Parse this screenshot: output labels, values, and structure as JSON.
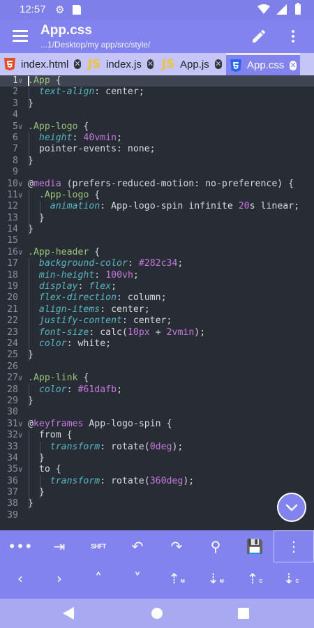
{
  "status": {
    "time": "12:57"
  },
  "app_bar": {
    "title": "App.css",
    "path": "...1/Desktop/my app/src/style/"
  },
  "tabs": [
    {
      "label": "index.html",
      "icon": "html5-icon",
      "active": false
    },
    {
      "label": "index.js",
      "icon": "javascript-icon",
      "active": false
    },
    {
      "label": "App.js",
      "icon": "javascript-icon",
      "active": false
    },
    {
      "label": "App.css",
      "icon": "css3-icon",
      "active": true
    }
  ],
  "tab_icons": {
    "js_text": "JS",
    "close_glyph": "✕"
  },
  "editor": {
    "current_line": 1,
    "lines": [
      {
        "n": "1",
        "fold": "∨",
        "tokens": [
          [
            ".App",
            "t-sel"
          ],
          [
            " {",
            "t-plain"
          ]
        ]
      },
      {
        "n": "2",
        "tokens": [
          [
            "  ",
            "t-plain"
          ],
          [
            "text-align",
            "t-prop"
          ],
          [
            ": center;",
            "t-plain"
          ]
        ]
      },
      {
        "n": "3",
        "tokens": [
          [
            "}",
            "t-plain"
          ]
        ]
      },
      {
        "n": "4",
        "tokens": []
      },
      {
        "n": "5",
        "fold": "∨",
        "tokens": [
          [
            ".App-logo",
            "t-sel"
          ],
          [
            " {",
            "t-plain"
          ]
        ]
      },
      {
        "n": "6",
        "tokens": [
          [
            "  ",
            "t-plain"
          ],
          [
            "height",
            "t-prop"
          ],
          [
            ": ",
            "t-plain"
          ],
          [
            "40",
            "t-num"
          ],
          [
            "vmin",
            "t-unit"
          ],
          [
            ";",
            "t-plain"
          ]
        ]
      },
      {
        "n": "7",
        "tokens": [
          [
            "  pointer-events: none;",
            "t-plain"
          ]
        ]
      },
      {
        "n": "8",
        "tokens": [
          [
            "}",
            "t-plain"
          ]
        ]
      },
      {
        "n": "9",
        "tokens": []
      },
      {
        "n": "10",
        "fold": "∨",
        "tokens": [
          [
            "@",
            "t-plain"
          ],
          [
            "media",
            "t-at"
          ],
          [
            " (prefers-reduced-motion: no-preference) {",
            "t-plain"
          ]
        ]
      },
      {
        "n": "11",
        "fold": "∨",
        "tokens": [
          [
            "  ",
            "t-plain"
          ],
          [
            ".App-logo",
            "t-sel"
          ],
          [
            " {",
            "t-plain"
          ]
        ]
      },
      {
        "n": "12",
        "tokens": [
          [
            "    ",
            "t-plain"
          ],
          [
            "animation",
            "t-prop"
          ],
          [
            ": App-logo-spin infinite ",
            "t-plain"
          ],
          [
            "20",
            "t-num"
          ],
          [
            "s linear;",
            "t-plain"
          ]
        ]
      },
      {
        "n": "13",
        "tokens": [
          [
            "  }",
            "t-plain"
          ]
        ]
      },
      {
        "n": "14",
        "tokens": [
          [
            "}",
            "t-plain"
          ]
        ]
      },
      {
        "n": "15",
        "tokens": []
      },
      {
        "n": "16",
        "fold": "∨",
        "tokens": [
          [
            ".App-header",
            "t-sel"
          ],
          [
            " {",
            "t-plain"
          ]
        ]
      },
      {
        "n": "17",
        "tokens": [
          [
            "  ",
            "t-plain"
          ],
          [
            "background-color",
            "t-prop"
          ],
          [
            ": ",
            "t-plain"
          ],
          [
            "#282c34",
            "t-num"
          ],
          [
            ";",
            "t-plain"
          ]
        ]
      },
      {
        "n": "18",
        "tokens": [
          [
            "  ",
            "t-plain"
          ],
          [
            "min-height",
            "t-prop"
          ],
          [
            ": ",
            "t-plain"
          ],
          [
            "100",
            "t-num"
          ],
          [
            "vh",
            "t-unit"
          ],
          [
            ";",
            "t-plain"
          ]
        ]
      },
      {
        "n": "19",
        "tokens": [
          [
            "  ",
            "t-plain"
          ],
          [
            "display",
            "t-prop"
          ],
          [
            ": ",
            "t-plain"
          ],
          [
            "flex",
            "t-prop"
          ],
          [
            ";",
            "t-plain"
          ]
        ]
      },
      {
        "n": "20",
        "tokens": [
          [
            "  ",
            "t-plain"
          ],
          [
            "flex-direction",
            "t-prop"
          ],
          [
            ": column;",
            "t-plain"
          ]
        ]
      },
      {
        "n": "21",
        "tokens": [
          [
            "  ",
            "t-plain"
          ],
          [
            "align-items",
            "t-prop"
          ],
          [
            ": center;",
            "t-plain"
          ]
        ]
      },
      {
        "n": "22",
        "tokens": [
          [
            "  ",
            "t-plain"
          ],
          [
            "justify-content",
            "t-prop"
          ],
          [
            ": center;",
            "t-plain"
          ]
        ]
      },
      {
        "n": "23",
        "tokens": [
          [
            "  ",
            "t-plain"
          ],
          [
            "font-size",
            "t-prop"
          ],
          [
            ": calc(",
            "t-plain"
          ],
          [
            "10",
            "t-num"
          ],
          [
            "px",
            "t-unit"
          ],
          [
            " + ",
            "t-plain"
          ],
          [
            "2",
            "t-num"
          ],
          [
            "vmin",
            "t-unit"
          ],
          [
            ");",
            "t-plain"
          ]
        ]
      },
      {
        "n": "24",
        "tokens": [
          [
            "  ",
            "t-plain"
          ],
          [
            "color",
            "t-prop"
          ],
          [
            ": white;",
            "t-plain"
          ]
        ]
      },
      {
        "n": "25",
        "tokens": [
          [
            "}",
            "t-plain"
          ]
        ]
      },
      {
        "n": "26",
        "tokens": []
      },
      {
        "n": "27",
        "fold": "∨",
        "tokens": [
          [
            ".App-link",
            "t-sel"
          ],
          [
            " {",
            "t-plain"
          ]
        ]
      },
      {
        "n": "28",
        "tokens": [
          [
            "  ",
            "t-plain"
          ],
          [
            "color",
            "t-prop"
          ],
          [
            ": ",
            "t-plain"
          ],
          [
            "#61dafb",
            "t-num"
          ],
          [
            ";",
            "t-plain"
          ]
        ]
      },
      {
        "n": "29",
        "tokens": [
          [
            "}",
            "t-plain"
          ]
        ]
      },
      {
        "n": "30",
        "tokens": []
      },
      {
        "n": "31",
        "fold": "∨",
        "tokens": [
          [
            "@",
            "t-plain"
          ],
          [
            "keyframes",
            "t-at"
          ],
          [
            " App-logo-spin {",
            "t-plain"
          ]
        ]
      },
      {
        "n": "32",
        "fold": "∨",
        "tokens": [
          [
            "  from {",
            "t-plain"
          ]
        ]
      },
      {
        "n": "33",
        "tokens": [
          [
            "    ",
            "t-plain"
          ],
          [
            "transform",
            "t-prop"
          ],
          [
            ": rotate(",
            "t-plain"
          ],
          [
            "0",
            "t-num"
          ],
          [
            "deg",
            "t-unit"
          ],
          [
            ");",
            "t-plain"
          ]
        ]
      },
      {
        "n": "34",
        "tokens": [
          [
            "  }",
            "t-plain"
          ]
        ]
      },
      {
        "n": "35",
        "fold": "∨",
        "tokens": [
          [
            "  to {",
            "t-plain"
          ]
        ]
      },
      {
        "n": "36",
        "tokens": [
          [
            "    ",
            "t-plain"
          ],
          [
            "transform",
            "t-prop"
          ],
          [
            ": rotate(",
            "t-plain"
          ],
          [
            "360",
            "t-num"
          ],
          [
            "deg",
            "t-unit"
          ],
          [
            ");",
            "t-plain"
          ]
        ]
      },
      {
        "n": "37",
        "tokens": [
          [
            "  }",
            "t-plain"
          ]
        ]
      },
      {
        "n": "38",
        "tokens": [
          [
            "}",
            "t-plain"
          ]
        ]
      },
      {
        "n": "39",
        "tokens": []
      }
    ]
  },
  "toolbar": {
    "row1": [
      {
        "name": "more-symbols-button",
        "glyph": "•••"
      },
      {
        "name": "tab-key-button",
        "glyph": "⇥"
      },
      {
        "name": "shift-button",
        "glyph": "SHFT"
      },
      {
        "name": "undo-button",
        "glyph": "↶"
      },
      {
        "name": "redo-button",
        "glyph": "↷"
      },
      {
        "name": "search-button",
        "glyph": "⚲"
      },
      {
        "name": "save-button",
        "glyph": "💾"
      },
      {
        "name": "overflow-menu-button",
        "glyph": "⋮"
      }
    ],
    "row2": [
      {
        "name": "cursor-left-button",
        "glyph": "‹",
        "sub": ""
      },
      {
        "name": "cursor-right-button",
        "glyph": "›",
        "sub": ""
      },
      {
        "name": "cursor-up-button",
        "glyph": "˄",
        "sub": ""
      },
      {
        "name": "cursor-down-button",
        "glyph": "˅",
        "sub": ""
      },
      {
        "name": "move-line-up-button",
        "glyph": "⇡",
        "sub": "M"
      },
      {
        "name": "move-line-down-button",
        "glyph": "⇣",
        "sub": "M"
      },
      {
        "name": "copy-line-up-button",
        "glyph": "⇡",
        "sub": "C"
      },
      {
        "name": "copy-line-down-button",
        "glyph": "⇣",
        "sub": "C"
      }
    ]
  },
  "colors": {
    "accent": "#8383f0",
    "status_bar": "#7f7fea",
    "tab_bg": "#c5c5f7",
    "editor_bg": "#282c34",
    "selector": "#98c379",
    "property": "#56b6c2",
    "number": "#c678dd"
  }
}
